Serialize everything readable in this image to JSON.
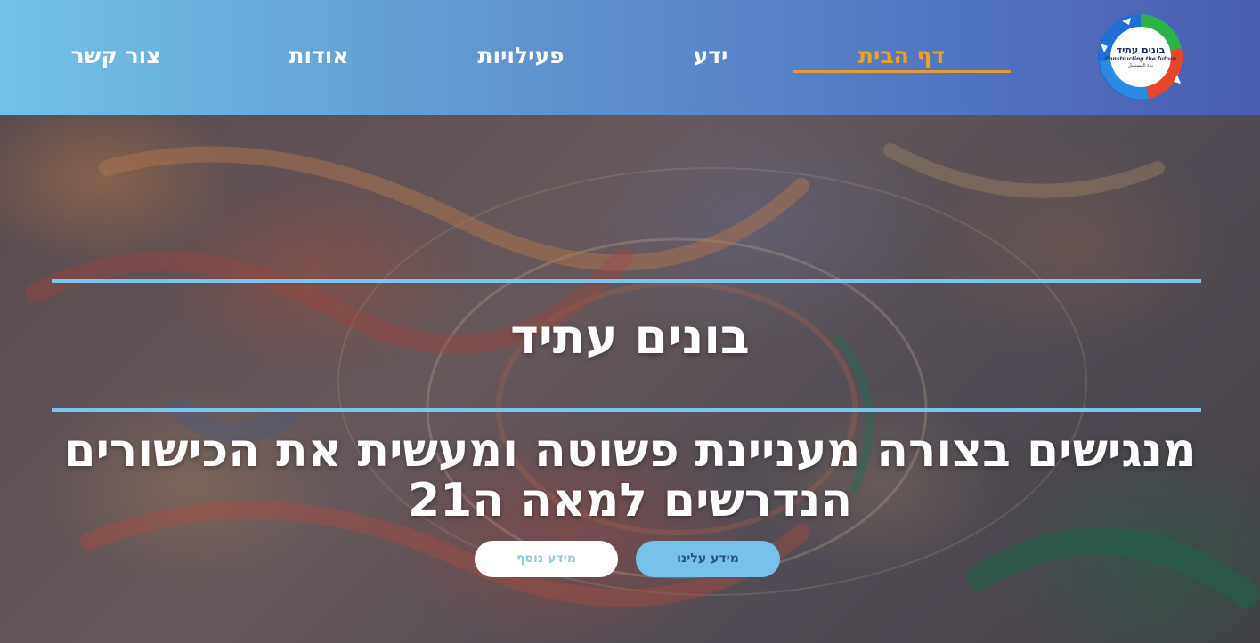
{
  "header": {
    "logo": {
      "title": "בונים עתיד",
      "subtitle_en": "Constructing the future",
      "subtitle_ar": "بناء المستقبل",
      "colors": [
        "#2bb34a",
        "#e8452a",
        "#1e6fd6",
        "#ffffff"
      ]
    },
    "nav": [
      {
        "label": "דף הבית",
        "active": true
      },
      {
        "label": "ידע",
        "active": false
      },
      {
        "label": "פעילויות",
        "active": false
      },
      {
        "label": "אודות",
        "active": false
      },
      {
        "label": "צור קשר",
        "active": false
      }
    ]
  },
  "hero": {
    "title": "בונים עתיד",
    "subtitle": "מנגישים בצורה מעניינת פשוטה ומעשית את הכישורים הנדרשים למאה ה21",
    "buttons": {
      "about": "מידע עלינו",
      "more": "מידע נוסף"
    }
  },
  "colors": {
    "accent_blue": "#7cc4ec",
    "active_nav": "#f0a020",
    "header_gradient_start": "#72c2e8",
    "header_gradient_end": "#4a5cb0"
  }
}
